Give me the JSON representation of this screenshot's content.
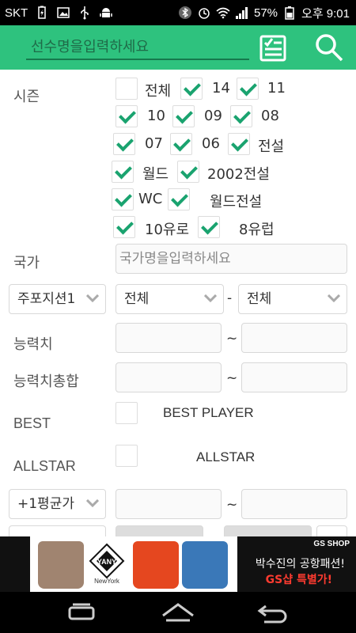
{
  "status_bar": {
    "carrier": "SKT",
    "battery": "57%",
    "time": "오후 9:01"
  },
  "app_bar": {
    "search_placeholder": "선수명을입력하세요",
    "list_icon": "checklist-icon",
    "search_icon": "search-icon"
  },
  "form": {
    "season_label": "시즌",
    "season_options": [
      {
        "label": "전체",
        "checked": false
      },
      {
        "label": "14",
        "checked": true
      },
      {
        "label": "11",
        "checked": true
      },
      {
        "label": "10",
        "checked": true
      },
      {
        "label": "09",
        "checked": true
      },
      {
        "label": "08",
        "checked": true
      },
      {
        "label": "07",
        "checked": true
      },
      {
        "label": "06",
        "checked": true
      },
      {
        "label": "전설",
        "checked": true
      },
      {
        "label": "월드",
        "checked": true
      },
      {
        "label": "2002전설",
        "checked": true
      },
      {
        "label": "WC",
        "checked": true
      },
      {
        "label": "월드전설",
        "checked": true
      },
      {
        "label": "10유로",
        "checked": true
      },
      {
        "label": "8유럽",
        "checked": true
      }
    ],
    "country_label": "국가",
    "country_placeholder": "국가명을입력하세요",
    "position_select": "주포지션1",
    "position_from": "전체",
    "position_dash": "-",
    "position_to": "전체",
    "ability_label": "능력치",
    "ability_total_label": "능력치총합",
    "tilde": "~",
    "best_label": "BEST",
    "best_option": "BEST PLAYER",
    "allstar_label": "ALLSTAR",
    "allstar_option": "ALLSTAR",
    "avg_select": "+1평균가"
  },
  "ad": {
    "brand": "GS SHOP",
    "line1": "박수진의 공항패션!",
    "line2": "GS샵 특별가!",
    "logo_text": "YANY",
    "logo_sub": "NewYork"
  },
  "colors": {
    "accent": "#2ec27e",
    "check": "#1aa36f"
  }
}
